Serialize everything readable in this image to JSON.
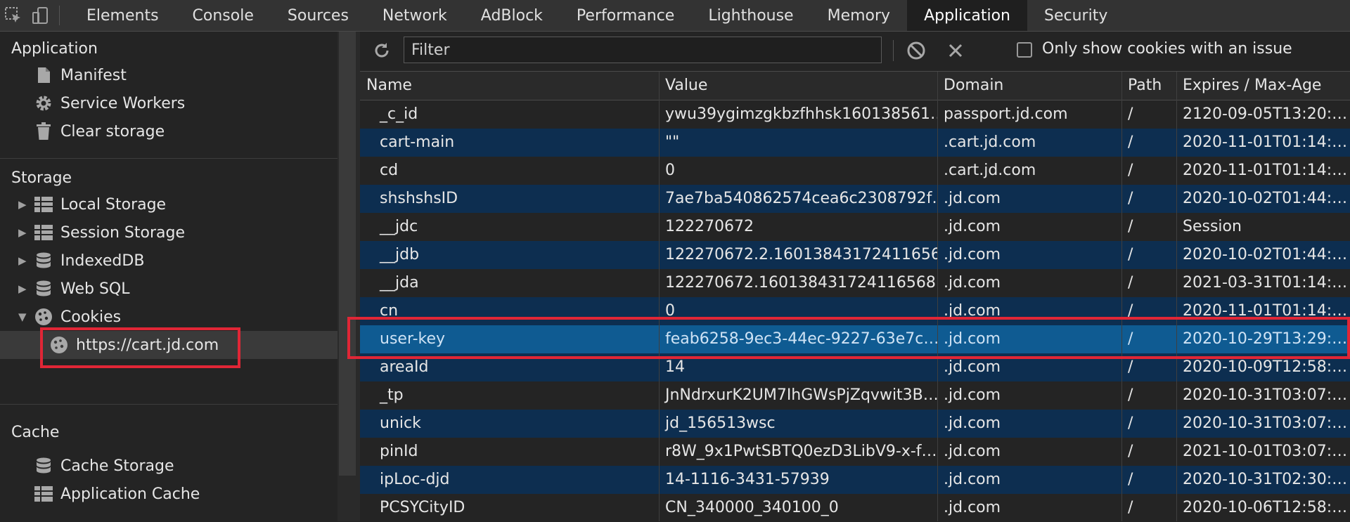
{
  "tabs": [
    "Elements",
    "Console",
    "Sources",
    "Network",
    "AdBlock",
    "Performance",
    "Lighthouse",
    "Memory",
    "Application",
    "Security"
  ],
  "active_tab": "Application",
  "sidebar": {
    "application": {
      "title": "Application",
      "items": [
        "Manifest",
        "Service Workers",
        "Clear storage"
      ]
    },
    "storage": {
      "title": "Storage",
      "items": [
        "Local Storage",
        "Session Storage",
        "IndexedDB",
        "Web SQL",
        "Cookies"
      ],
      "cookie_origin": "https://cart.jd.com"
    },
    "cache": {
      "title": "Cache",
      "items": [
        "Cache Storage",
        "Application Cache"
      ]
    }
  },
  "toolbar": {
    "filter_placeholder": "Filter",
    "only_issue_label": "Only show cookies with an issue"
  },
  "table": {
    "headers": [
      "Name",
      "Value",
      "Domain",
      "Path",
      "Expires / Max-Age"
    ],
    "rows": [
      [
        "_c_id",
        "ywu39ygimzgkbzfhhsk160138561…",
        "passport.jd.com",
        "/",
        "2120-09-05T13:20:…"
      ],
      [
        "cart-main",
        "\"\"",
        ".cart.jd.com",
        "/",
        "2020-11-01T01:14:…"
      ],
      [
        "cd",
        "0",
        ".cart.jd.com",
        "/",
        "2020-11-01T01:14:…"
      ],
      [
        "shshshsID",
        "7ae7ba540862574cea6c2308792f…",
        ".jd.com",
        "/",
        "2020-10-02T01:44:…"
      ],
      [
        "__jdc",
        "122270672",
        ".jd.com",
        "/",
        "Session"
      ],
      [
        "__jdb",
        "122270672.2.16013843172411656…",
        ".jd.com",
        "/",
        "2020-10-02T01:44:…"
      ],
      [
        "__jda",
        "122270672.160138431724116568…",
        ".jd.com",
        "/",
        "2021-03-31T01:14:…"
      ],
      [
        "cn",
        "0",
        ".jd.com",
        "/",
        "2020-11-01T01:14:…"
      ],
      [
        "user-key",
        "feab6258-9ec3-44ec-9227-63e7c…",
        ".jd.com",
        "/",
        "2020-10-29T13:29:…"
      ],
      [
        "areaId",
        "14",
        ".jd.com",
        "/",
        "2020-10-09T12:58:…"
      ],
      [
        "_tp",
        "JnNdrxurK2UM7IhGWsPjZqvwit3B…",
        ".jd.com",
        "/",
        "2020-10-31T03:07:…"
      ],
      [
        "unick",
        "jd_156513wsc",
        ".jd.com",
        "/",
        "2020-10-31T03:07:…"
      ],
      [
        "pinId",
        "r8W_9x1PwtSBTQ0ezD3LibV9-x-f…",
        ".jd.com",
        "/",
        "2021-10-01T03:07:…"
      ],
      [
        "ipLoc-djd",
        "14-1116-3431-57939",
        ".jd.com",
        "/",
        "2020-10-31T02:30:…"
      ],
      [
        "PCSYCityID",
        "CN_340000_340100_0",
        ".jd.com",
        "/",
        "2020-10-06T12:58:…"
      ]
    ],
    "selected_row": "user-key"
  },
  "colors": {
    "highlight": "#e02636",
    "selected_row": "#0f5b92",
    "alt_row": "#0d2e50"
  }
}
